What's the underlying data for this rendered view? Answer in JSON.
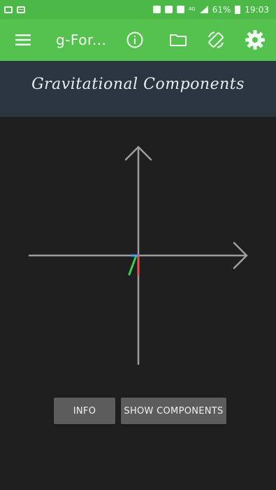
{
  "status_bar": {
    "battery_percent": "61%",
    "time": "19:03",
    "network_label": "4G",
    "left_icons": [
      "gallery-icon",
      "message-icon"
    ],
    "right_icons": [
      "alarm-icon",
      "data-saver-icon",
      "nfc-icon",
      "network-icon",
      "signal-icon",
      "battery-icon"
    ]
  },
  "app_bar": {
    "title": "g-For...",
    "icons": [
      "menu-icon",
      "info-icon",
      "folder-icon",
      "rotate-screen-icon",
      "settings-icon"
    ]
  },
  "header": {
    "title": "Gravitational Components"
  },
  "visualization": {
    "axis_color": "#9e9e9e",
    "vectors": [
      {
        "name": "x-component",
        "color": "#3fa9f5"
      },
      {
        "name": "y-component",
        "color": "#f04b4b"
      },
      {
        "name": "z-component",
        "color": "#3ccf4e"
      }
    ]
  },
  "buttons": {
    "info": "INFO",
    "show_components": "SHOW COMPONENTS"
  },
  "colors": {
    "accent": "#55c14f",
    "status_bar": "#4cb848",
    "title_band": "#2b3540",
    "background": "#1f1f1f",
    "button": "#5c5c5c"
  }
}
